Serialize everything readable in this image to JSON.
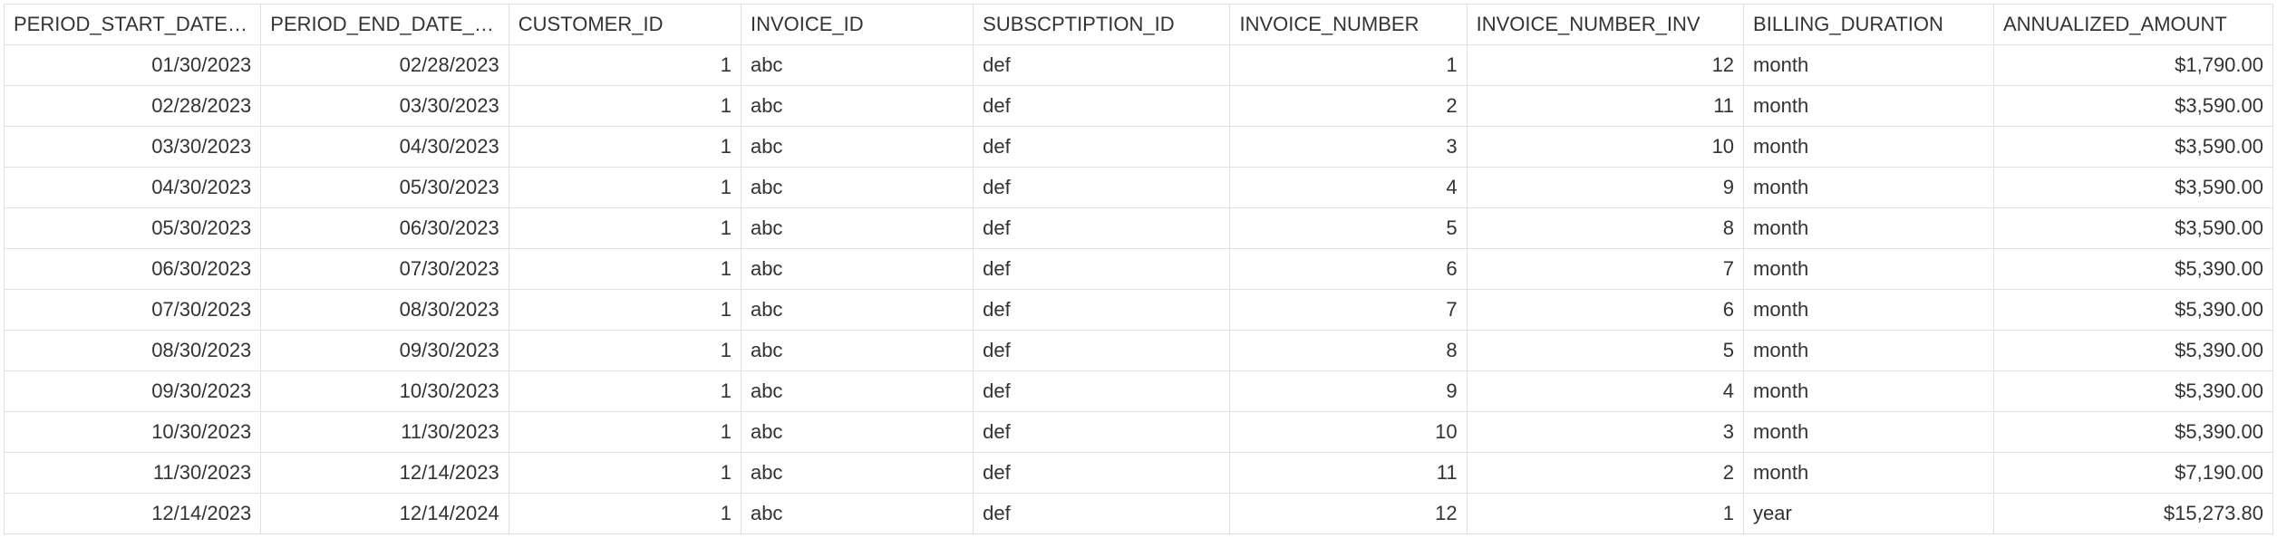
{
  "table": {
    "columns": [
      {
        "label": "PERIOD_START_DATE_CLEAN",
        "align": "left"
      },
      {
        "label": "PERIOD_END_DATE_CLEAN",
        "align": "left"
      },
      {
        "label": "CUSTOMER_ID",
        "align": "left"
      },
      {
        "label": "INVOICE_ID",
        "align": "left"
      },
      {
        "label": "SUBSCPTIPTION_ID",
        "align": "left"
      },
      {
        "label": "INVOICE_NUMBER",
        "align": "left"
      },
      {
        "label": "INVOICE_NUMBER_INV",
        "align": "left"
      },
      {
        "label": "BILLING_DURATION",
        "align": "left"
      },
      {
        "label": "ANNUALIZED_AMOUNT",
        "align": "left"
      }
    ],
    "colAlign": [
      "right",
      "right",
      "right",
      "left",
      "left",
      "right",
      "right",
      "left",
      "right"
    ],
    "rows": [
      [
        "01/30/2023",
        "02/28/2023",
        "1",
        "abc",
        "def",
        "1",
        "12",
        "month",
        "$1,790.00"
      ],
      [
        "02/28/2023",
        "03/30/2023",
        "1",
        "abc",
        "def",
        "2",
        "11",
        "month",
        "$3,590.00"
      ],
      [
        "03/30/2023",
        "04/30/2023",
        "1",
        "abc",
        "def",
        "3",
        "10",
        "month",
        "$3,590.00"
      ],
      [
        "04/30/2023",
        "05/30/2023",
        "1",
        "abc",
        "def",
        "4",
        "9",
        "month",
        "$3,590.00"
      ],
      [
        "05/30/2023",
        "06/30/2023",
        "1",
        "abc",
        "def",
        "5",
        "8",
        "month",
        "$3,590.00"
      ],
      [
        "06/30/2023",
        "07/30/2023",
        "1",
        "abc",
        "def",
        "6",
        "7",
        "month",
        "$5,390.00"
      ],
      [
        "07/30/2023",
        "08/30/2023",
        "1",
        "abc",
        "def",
        "7",
        "6",
        "month",
        "$5,390.00"
      ],
      [
        "08/30/2023",
        "09/30/2023",
        "1",
        "abc",
        "def",
        "8",
        "5",
        "month",
        "$5,390.00"
      ],
      [
        "09/30/2023",
        "10/30/2023",
        "1",
        "abc",
        "def",
        "9",
        "4",
        "month",
        "$5,390.00"
      ],
      [
        "10/30/2023",
        "11/30/2023",
        "1",
        "abc",
        "def",
        "10",
        "3",
        "month",
        "$5,390.00"
      ],
      [
        "11/30/2023",
        "12/14/2023",
        "1",
        "abc",
        "def",
        "11",
        "2",
        "month",
        "$7,190.00"
      ],
      [
        "12/14/2023",
        "12/14/2024",
        "1",
        "abc",
        "def",
        "12",
        "1",
        "year",
        "$15,273.80"
      ]
    ]
  }
}
